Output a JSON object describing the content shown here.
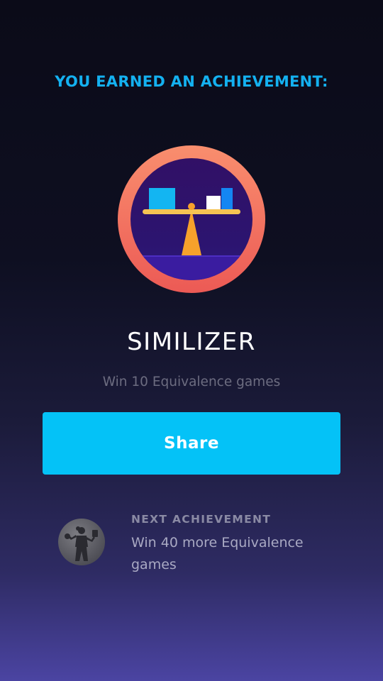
{
  "earned": {
    "heading": "YOU EARNED AN ACHIEVEMENT:"
  },
  "achievement": {
    "badge_icon": "balance-scale-icon",
    "title": "SIMILIZER",
    "description": "Win 10 Equivalence games"
  },
  "actions": {
    "share_label": "Share"
  },
  "next": {
    "label": "NEXT ACHIEVEMENT",
    "description": "Win 40 more Equivalence games",
    "icon": "person-juggling-icon"
  },
  "colors": {
    "heading_accent": "#14b1f0",
    "share_button": "#04c2f7",
    "badge_ring": "#f2705e",
    "badge_inner": "#2f136f",
    "scale_beam": "#f6c353",
    "scale_stand": "#f7a12b"
  }
}
